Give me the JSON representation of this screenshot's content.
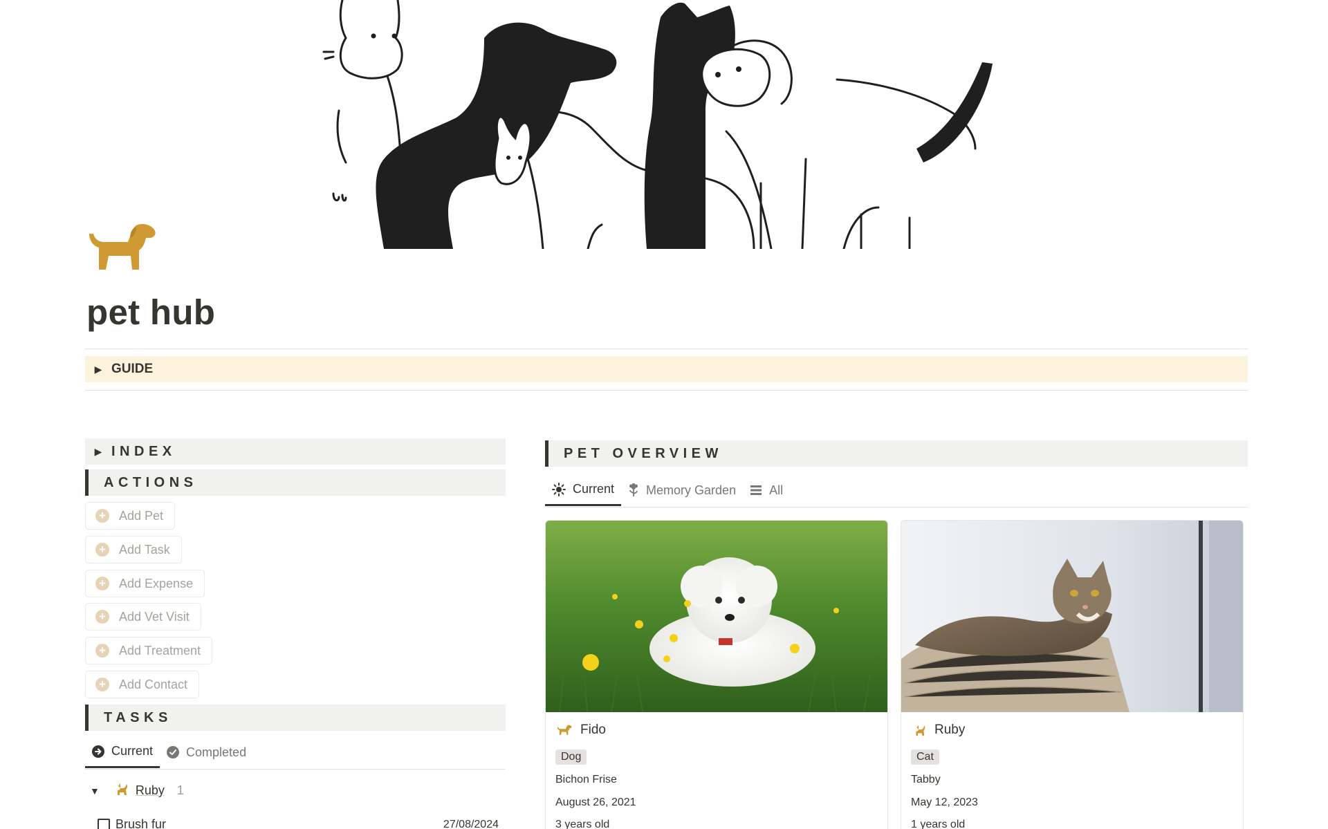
{
  "page": {
    "title": "pet hub",
    "icon": "dog-icon",
    "cover": "pet-illustration-cover"
  },
  "guide": {
    "label": "GUIDE"
  },
  "index": {
    "label": "INDEX"
  },
  "actions": {
    "label": "ACTIONS",
    "buttons": [
      {
        "label": "Add Pet"
      },
      {
        "label": "Add Task"
      },
      {
        "label": "Add Expense"
      },
      {
        "label": "Add Vet Visit"
      },
      {
        "label": "Add Treatment"
      },
      {
        "label": "Add Contact"
      }
    ]
  },
  "tasks": {
    "label": "TASKS",
    "tabs": [
      {
        "label": "Current",
        "icon": "arrow-circle-icon",
        "active": true
      },
      {
        "label": "Completed",
        "icon": "check-circle-icon",
        "active": false
      }
    ],
    "group": {
      "name": "Ruby",
      "count": "1",
      "icon": "cat-icon"
    },
    "items": [
      {
        "title": "Brush fur",
        "date": "27/08/2024",
        "done": false
      }
    ]
  },
  "overview": {
    "label": "PET OVERVIEW",
    "tabs": [
      {
        "label": "Current",
        "icon": "sun-icon",
        "active": true
      },
      {
        "label": "Memory Garden",
        "icon": "flower-icon",
        "active": false
      },
      {
        "label": "All",
        "icon": "list-icon",
        "active": false
      }
    ],
    "pets": [
      {
        "name": "Fido",
        "icon": "dog-icon",
        "species": "Dog",
        "breed": "Bichon Frise",
        "birthday": "August 26, 2021",
        "age": "3 years old"
      },
      {
        "name": "Ruby",
        "icon": "cat-icon",
        "species": "Cat",
        "breed": "Tabby",
        "birthday": "May 12, 2023",
        "age": "1 years old"
      }
    ]
  },
  "colors": {
    "accent": "#cf9a34",
    "guide_bg": "#fbf3db",
    "section_bg": "#f1f1ef",
    "text": "#37352f"
  }
}
